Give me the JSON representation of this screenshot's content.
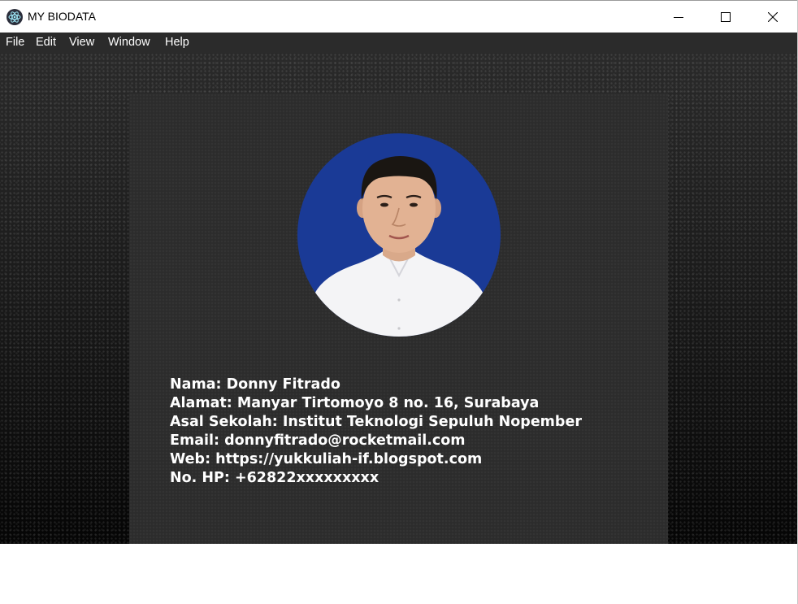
{
  "window": {
    "title": "MY BIODATA"
  },
  "menu": {
    "items": [
      "File",
      "Edit",
      "View",
      "Window",
      "Help"
    ]
  },
  "icons": {
    "app": "electron-atom-icon",
    "minimize": "minimize-icon",
    "maximize": "maximize-icon",
    "close": "close-icon"
  },
  "profile": {
    "photo_background": "#1a3a96",
    "lines": [
      "Nama: Donny Fitrado",
      "Alamat: Manyar Tirtomoyo 8 no. 16, Surabaya",
      "Asal Sekolah: Institut Teknologi Sepuluh Nopember",
      "Email: donnyfitrado@rocketmail.com",
      "Web: https://yukkuliah-if.blogspot.com",
      "No. HP: +62822xxxxxxxxx"
    ]
  }
}
